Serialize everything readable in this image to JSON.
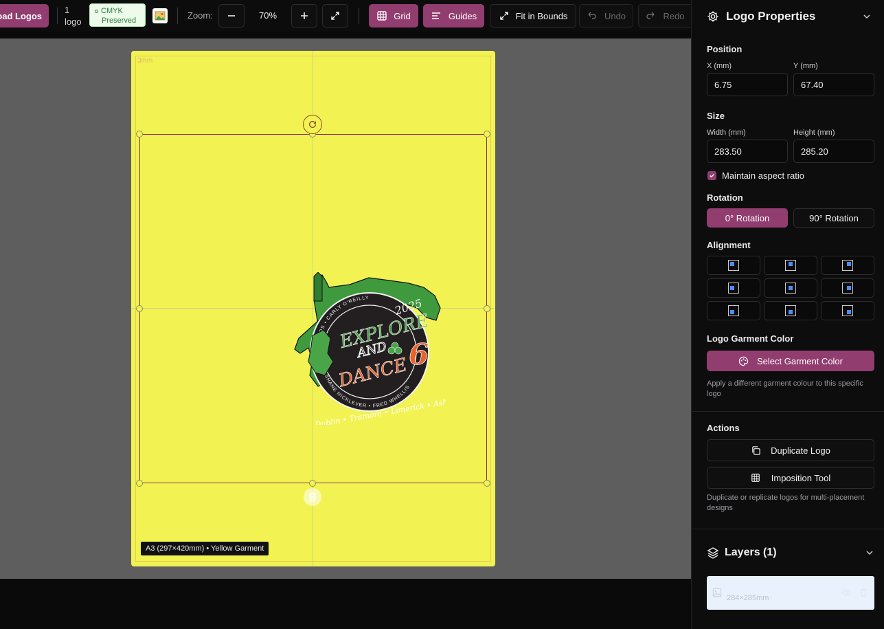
{
  "toolbar": {
    "upload_label": "oad Logos",
    "logo_count": "1",
    "logo_count_unit": "logo",
    "cmyk_line1": "CMYK",
    "cmyk_line2": "Preserved",
    "zoom_label": "Zoom:",
    "zoom_value": "70%",
    "grid_label": "Grid",
    "guides_label": "Guides",
    "fit_label": "Fit in Bounds",
    "undo_label": "Undo",
    "redo_label": "Redo"
  },
  "canvas": {
    "bleed_label": "3mm",
    "size_label": "A3 (297×420mm) • Yellow Garment",
    "garment_color": "#f2f352",
    "selection_color": "#8e2e57"
  },
  "logo": {
    "year": "2025",
    "line1": "EXPLORE",
    "line2": "AND",
    "line3": "DANCE",
    "number": "6",
    "ring_top": "TIA MOS • CARLY O'REILLY",
    "ring_bottom": "SHANE NICKLEVER • FRED WHELLIS",
    "footer": "Dublin • Tramore • Limerick • Ashbo"
  },
  "panel": {
    "title": "Logo Properties",
    "position_title": "Position",
    "x_label": "X (mm)",
    "x_value": "6.75",
    "y_label": "Y (mm)",
    "y_value": "67.40",
    "size_title": "Size",
    "width_label": "Width (mm)",
    "width_value": "283.50",
    "height_label": "Height (mm)",
    "height_value": "285.20",
    "aspect_label": "Maintain aspect ratio",
    "rotation_title": "Rotation",
    "rot0_label": "0° Rotation",
    "rot90_label": "90° Rotation",
    "alignment_title": "Alignment",
    "garment_title": "Logo Garment Color",
    "garment_button": "Select Garment Color",
    "garment_hint": "Apply a different garment colour to this specific logo",
    "actions_title": "Actions",
    "duplicate_label": "Duplicate Logo",
    "imposition_label": "Imposition Tool",
    "actions_hint": "Duplicate or replicate logos for multi-placement designs",
    "layers_title": "Layers (1)",
    "layer_size": "284×285mm",
    "accent": "#923d6f"
  }
}
